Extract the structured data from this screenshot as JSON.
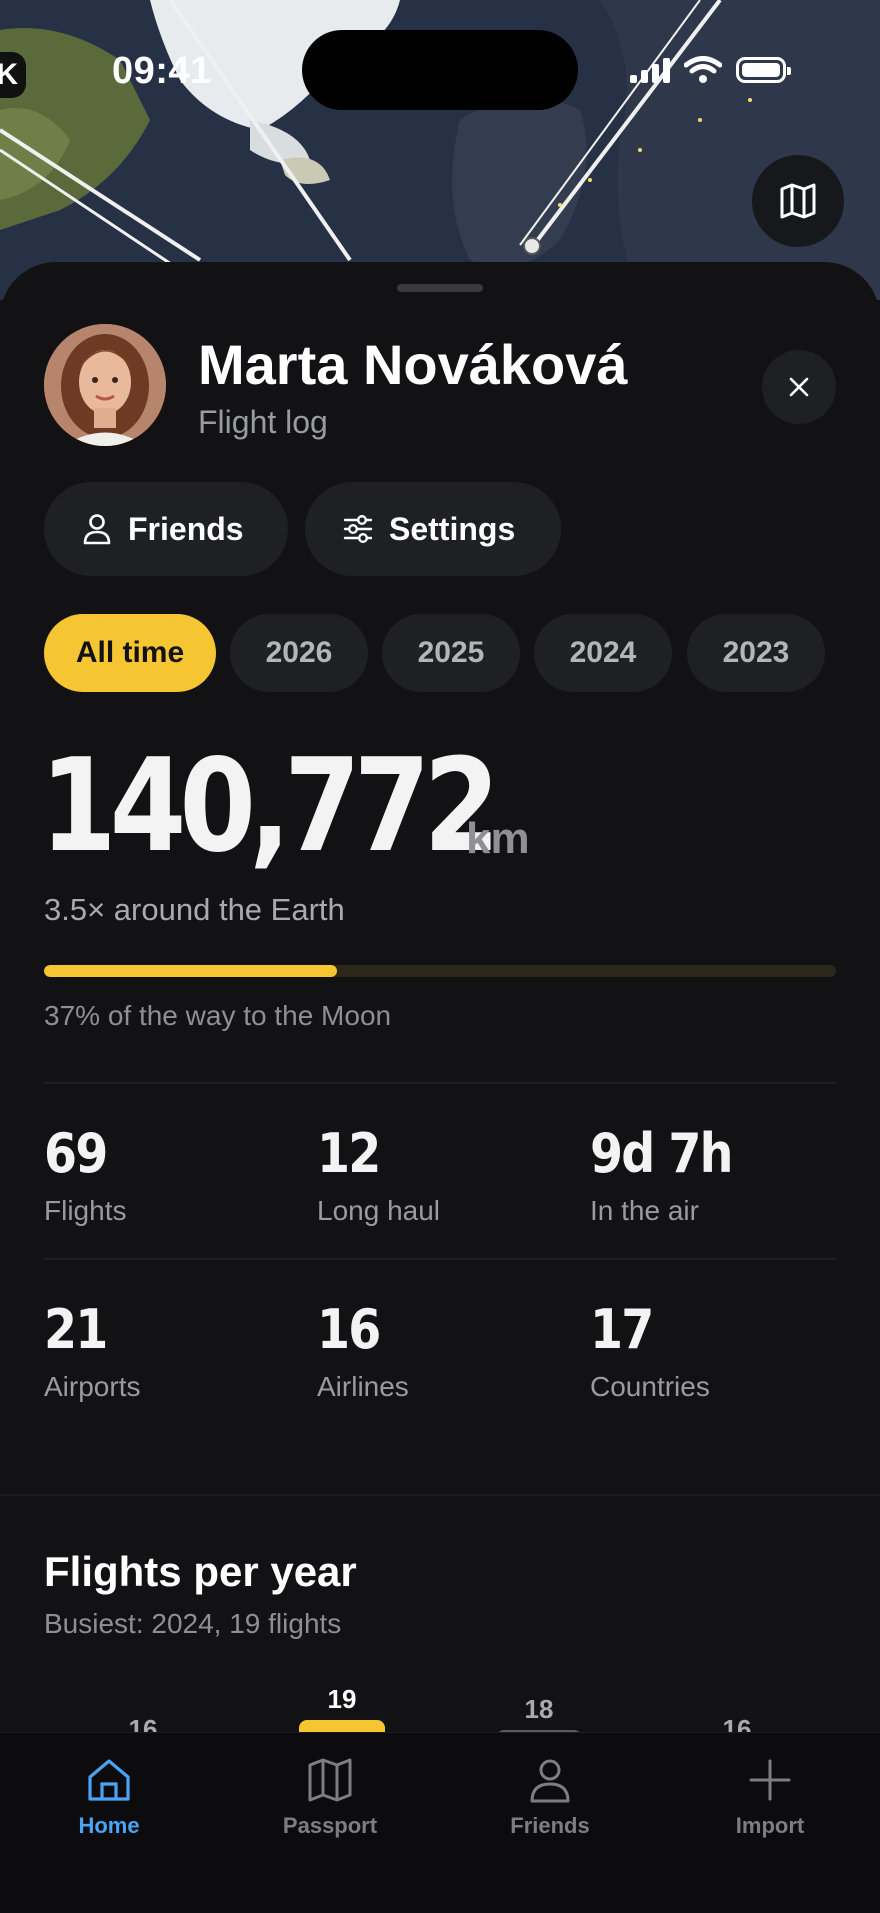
{
  "status_bar": {
    "time": "09:41",
    "back": "K"
  },
  "header": {
    "name": "Marta Nováková",
    "subtitle": "Flight log"
  },
  "actions": [
    {
      "label": "Friends",
      "icon": "person-icon"
    },
    {
      "label": "Settings",
      "icon": "sliders-icon"
    }
  ],
  "filters": {
    "selected": "All time",
    "options": [
      "All time",
      "2026",
      "2025",
      "2024",
      "2023"
    ]
  },
  "distance": {
    "value": "140,772",
    "unit": "km",
    "earth_text": "3.5× around the Earth",
    "moon_progress": 0.37,
    "moon_text": "37% of the way to the Moon"
  },
  "stats": [
    {
      "value": "69",
      "label": "Flights"
    },
    {
      "value": "12",
      "label": "Long haul"
    },
    {
      "value": "9d 7h",
      "label": "In the air"
    },
    {
      "value": "21",
      "label": "Airports"
    },
    {
      "value": "16",
      "label": "Airlines"
    },
    {
      "value": "17",
      "label": "Countries"
    }
  ],
  "flights_per_year": {
    "title": "Flights per year",
    "subtitle": "Busiest: 2024, 19 flights"
  },
  "chart_data": {
    "type": "bar",
    "values": [
      16,
      19,
      18,
      16
    ],
    "highlight_index": 1,
    "colors": {
      "highlight": "#f6c532",
      "default": "#5a5b60"
    }
  },
  "tabs": [
    {
      "label": "Home",
      "icon": "home-icon",
      "active": true
    },
    {
      "label": "Passport",
      "icon": "map-icon",
      "active": false
    },
    {
      "label": "Friends",
      "icon": "person-icon",
      "active": false
    },
    {
      "label": "Import",
      "icon": "plus-icon",
      "active": false
    }
  ],
  "colors": {
    "accent": "#f6c532",
    "tab_active": "#4aa3f5",
    "background": "#121214"
  }
}
